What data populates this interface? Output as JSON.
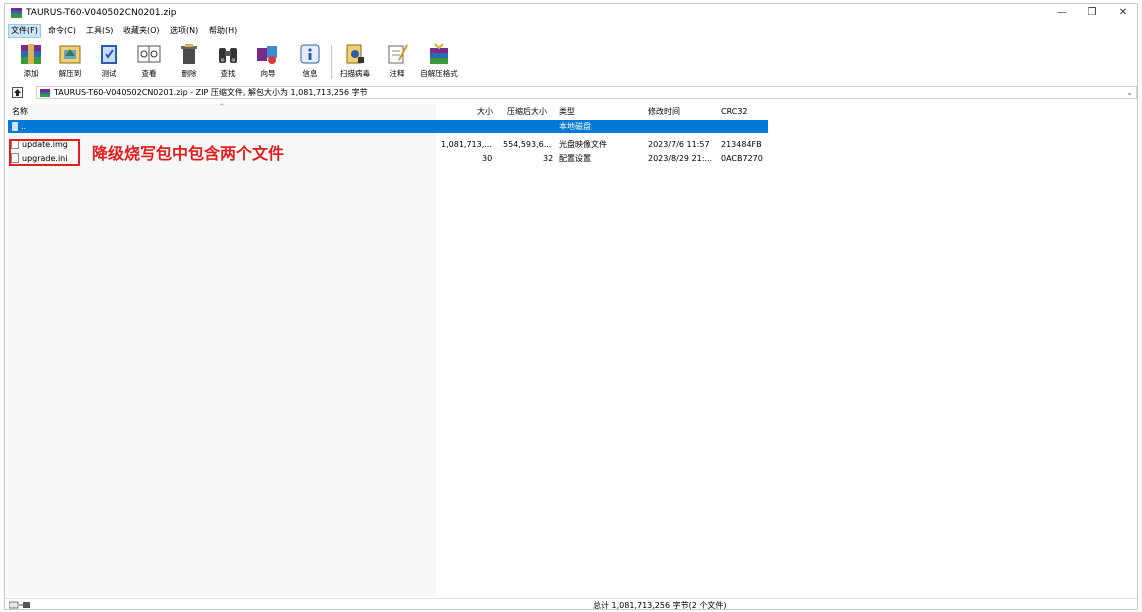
{
  "window": {
    "title": "TAURUS-T60-V040502CN0201.zip",
    "minimize": "—",
    "maximize": "❐",
    "close": "✕"
  },
  "menu": {
    "items": [
      {
        "label": "文件(F)"
      },
      {
        "label": "命令(C)"
      },
      {
        "label": "工具(S)"
      },
      {
        "label": "收藏夹(O)"
      },
      {
        "label": "选项(N)"
      },
      {
        "label": "帮助(H)"
      }
    ]
  },
  "toolbar": {
    "items": [
      {
        "label": "添加",
        "icon": "add-books-icon"
      },
      {
        "label": "解压到",
        "icon": "extract-folder-icon"
      },
      {
        "label": "测试",
        "icon": "test-book-icon"
      },
      {
        "label": "查看",
        "icon": "view-book-icon"
      },
      {
        "label": "删除",
        "icon": "delete-trash-icon"
      },
      {
        "label": "查找",
        "icon": "find-binoculars-icon"
      },
      {
        "label": "向导",
        "icon": "wizard-icon"
      },
      {
        "label": "信息",
        "icon": "info-icon"
      },
      {
        "label": "扫描病毒",
        "icon": "scan-virus-icon"
      },
      {
        "label": "注释",
        "icon": "comment-icon"
      },
      {
        "label": "自解压格式",
        "icon": "sfx-icon"
      }
    ]
  },
  "address": {
    "text": "TAURUS-T60-V040502CN0201.zip - ZIP 压缩文件, 解包大小为 1,081,713,256 字节",
    "dropdown": "⌄"
  },
  "columns": {
    "name": "名称",
    "size": "大小",
    "packed": "压缩后大小",
    "type": "类型",
    "modified": "修改时间",
    "crc": "CRC32"
  },
  "parent_row": {
    "name": "..",
    "type": "本地磁盘"
  },
  "files": [
    {
      "name": "update.img",
      "size": "1,081,713,...",
      "packed": "554,593,6...",
      "type": "光盘映像文件",
      "modified": "2023/7/6 11:57",
      "crc": "213484FB"
    },
    {
      "name": "upgrade.ini",
      "size": "30",
      "packed": "32",
      "type": "配置设置",
      "modified": "2023/8/29 21:...",
      "crc": "0ACB7270"
    }
  ],
  "annotation": {
    "text": "降级烧写包中包含两个文件"
  },
  "status": {
    "text": "总计 1,081,713,256 字节(2 个文件)"
  },
  "colors": {
    "selection": "#0078d7",
    "annotation": "#e02020"
  }
}
